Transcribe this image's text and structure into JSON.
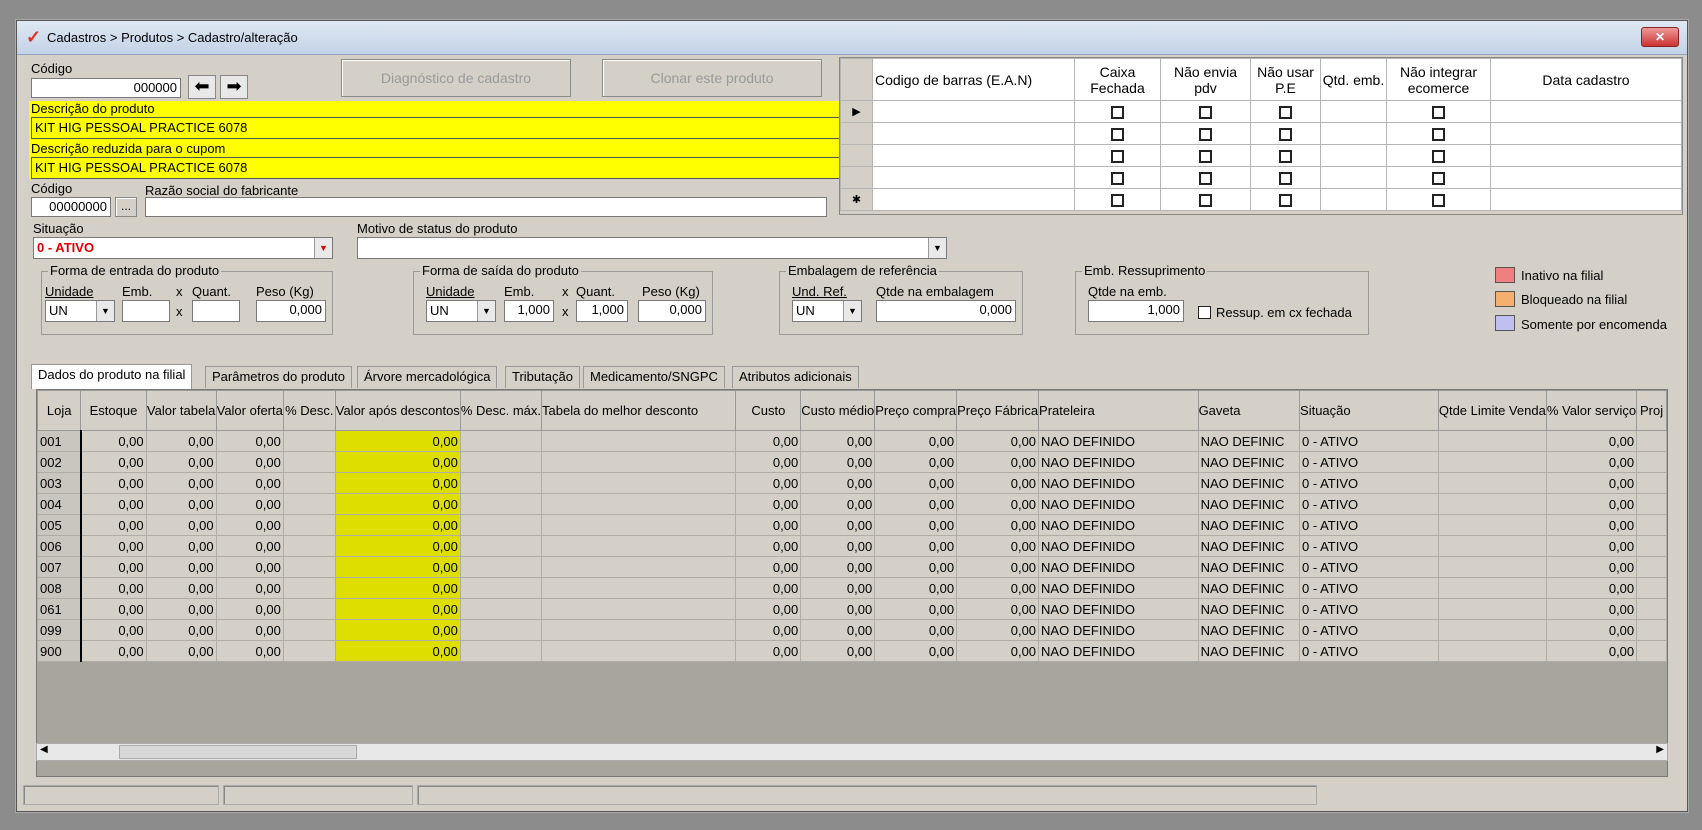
{
  "window": {
    "title": "Cadastros > Produtos > Cadastro/alteração",
    "close": "✕"
  },
  "form": {
    "codigo_label": "Código",
    "codigo_value": "000000",
    "diag_button": "Diagnóstico de cadastro",
    "clone_button": "Clonar este produto",
    "descricao_label": "Descrição  do produto",
    "descricao_value": "KIT HIG PESSOAL PRACTICE 6078",
    "reduzida_label": "Descrição reduzida para o cupom",
    "reduzida_value": "KIT HIG PESSOAL PRACTICE 6078",
    "fab_codigo_label": "Código",
    "fab_codigo_value": "00000000",
    "fab_browse": "...",
    "razao_label": "Razão social do fabricante",
    "razao_value": "",
    "situacao_label": "Situação",
    "situacao_value": "0 - ATIVO",
    "motivo_label": "Motivo de status do produto",
    "motivo_value": ""
  },
  "entrada": {
    "title": "Forma de entrada do produto",
    "unidade": "Unidade",
    "emb": "Emb.",
    "x": "x",
    "quant": "Quant.",
    "peso": "Peso (Kg)",
    "unidade_value": "UN",
    "emb_value": "",
    "quant_value": "",
    "peso_value": "0,000"
  },
  "saida": {
    "title": "Forma de saída do produto",
    "unidade": "Unidade",
    "emb": "Emb.",
    "x": "x",
    "quant": "Quant.",
    "peso": "Peso (Kg)",
    "unidade_value": "UN",
    "emb_value": "1,000",
    "quant_value": "1,000",
    "peso_value": "0,000"
  },
  "referencia": {
    "title": "Embalagem de referência",
    "und": "Und. Ref.",
    "qtde": "Qtde na embalagem",
    "und_value": "UN",
    "qtde_value": "0,000"
  },
  "ressup": {
    "title": "Emb. Ressuprimento",
    "qtde": "Qtde na emb.",
    "qtde_value": "1,000",
    "check": "Ressup. em cx fechada"
  },
  "legend": [
    {
      "label": "Inativo na filial",
      "color": "#f08080"
    },
    {
      "label": "Bloqueado na filial",
      "color": "#f5b070"
    },
    {
      "label": "Somente por encomenda",
      "color": "#c0c0f0"
    }
  ],
  "ean": {
    "headers": [
      "Codigo de barras (E.A.N)",
      "Caixa Fechada",
      "Não envia pdv",
      "Não usar P.E",
      "Qtd. emb.",
      "Não integrar ecomerce",
      "Data cadastro"
    ],
    "indicators": [
      "▶",
      "",
      "",
      "",
      "✱"
    ]
  },
  "tabs": [
    "Dados do produto na filial",
    "Parâmetros do produto",
    "Árvore mercadológica",
    "Tributação",
    "Medicamento/SNGPC",
    "Atributos adicionais"
  ],
  "grid": {
    "headers": [
      "Loja",
      "Estoque",
      "Valor tabela",
      "Valor oferta",
      "% Desc.",
      "Valor após descontos",
      "% Desc. máx.",
      "Tabela do melhor desconto",
      "Custo",
      "Custo médio",
      "Preço compra",
      "Preço Fábrica",
      "Prateleira",
      "Gaveta",
      "Situação",
      "Qtde Limite Venda",
      "% Valor serviço",
      "Proj"
    ],
    "rows": [
      [
        "001",
        "0,00",
        "0,00",
        "0,00",
        "",
        "0,00",
        "",
        "",
        "0,00",
        "0,00",
        "0,00",
        "0,00",
        "NAO DEFINIDO",
        "NAO DEFINIC",
        "0 - ATIVO",
        "",
        "0,00",
        ""
      ],
      [
        "002",
        "0,00",
        "0,00",
        "0,00",
        "",
        "0,00",
        "",
        "",
        "0,00",
        "0,00",
        "0,00",
        "0,00",
        "NAO DEFINIDO",
        "NAO DEFINIC",
        "0 - ATIVO",
        "",
        "0,00",
        ""
      ],
      [
        "003",
        "0,00",
        "0,00",
        "0,00",
        "",
        "0,00",
        "",
        "",
        "0,00",
        "0,00",
        "0,00",
        "0,00",
        "NAO DEFINIDO",
        "NAO DEFINIC",
        "0 - ATIVO",
        "",
        "0,00",
        ""
      ],
      [
        "004",
        "0,00",
        "0,00",
        "0,00",
        "",
        "0,00",
        "",
        "",
        "0,00",
        "0,00",
        "0,00",
        "0,00",
        "NAO DEFINIDO",
        "NAO DEFINIC",
        "0 - ATIVO",
        "",
        "0,00",
        ""
      ],
      [
        "005",
        "0,00",
        "0,00",
        "0,00",
        "",
        "0,00",
        "",
        "",
        "0,00",
        "0,00",
        "0,00",
        "0,00",
        "NAO DEFINIDO",
        "NAO DEFINIC",
        "0 - ATIVO",
        "",
        "0,00",
        ""
      ],
      [
        "006",
        "0,00",
        "0,00",
        "0,00",
        "",
        "0,00",
        "",
        "",
        "0,00",
        "0,00",
        "0,00",
        "0,00",
        "NAO DEFINIDO",
        "NAO DEFINIC",
        "0 - ATIVO",
        "",
        "0,00",
        ""
      ],
      [
        "007",
        "0,00",
        "0,00",
        "0,00",
        "",
        "0,00",
        "",
        "",
        "0,00",
        "0,00",
        "0,00",
        "0,00",
        "NAO DEFINIDO",
        "NAO DEFINIC",
        "0 - ATIVO",
        "",
        "0,00",
        ""
      ],
      [
        "008",
        "0,00",
        "0,00",
        "0,00",
        "",
        "0,00",
        "",
        "",
        "0,00",
        "0,00",
        "0,00",
        "0,00",
        "NAO DEFINIDO",
        "NAO DEFINIC",
        "0 - ATIVO",
        "",
        "0,00",
        ""
      ],
      [
        "061",
        "0,00",
        "0,00",
        "0,00",
        "",
        "0,00",
        "",
        "",
        "0,00",
        "0,00",
        "0,00",
        "0,00",
        "NAO DEFINIDO",
        "NAO DEFINIC",
        "0 - ATIVO",
        "",
        "0,00",
        ""
      ],
      [
        "099",
        "0,00",
        "0,00",
        "0,00",
        "",
        "0,00",
        "",
        "",
        "0,00",
        "0,00",
        "0,00",
        "0,00",
        "NAO DEFINIDO",
        "NAO DEFINIC",
        "0 - ATIVO",
        "",
        "0,00",
        ""
      ],
      [
        "900",
        "0,00",
        "0,00",
        "0,00",
        "",
        "0,00",
        "",
        "",
        "0,00",
        "0,00",
        "0,00",
        "0,00",
        "NAO DEFINIDO",
        "NAO DEFINIC",
        "0 - ATIVO",
        "",
        "0,00",
        ""
      ]
    ]
  }
}
